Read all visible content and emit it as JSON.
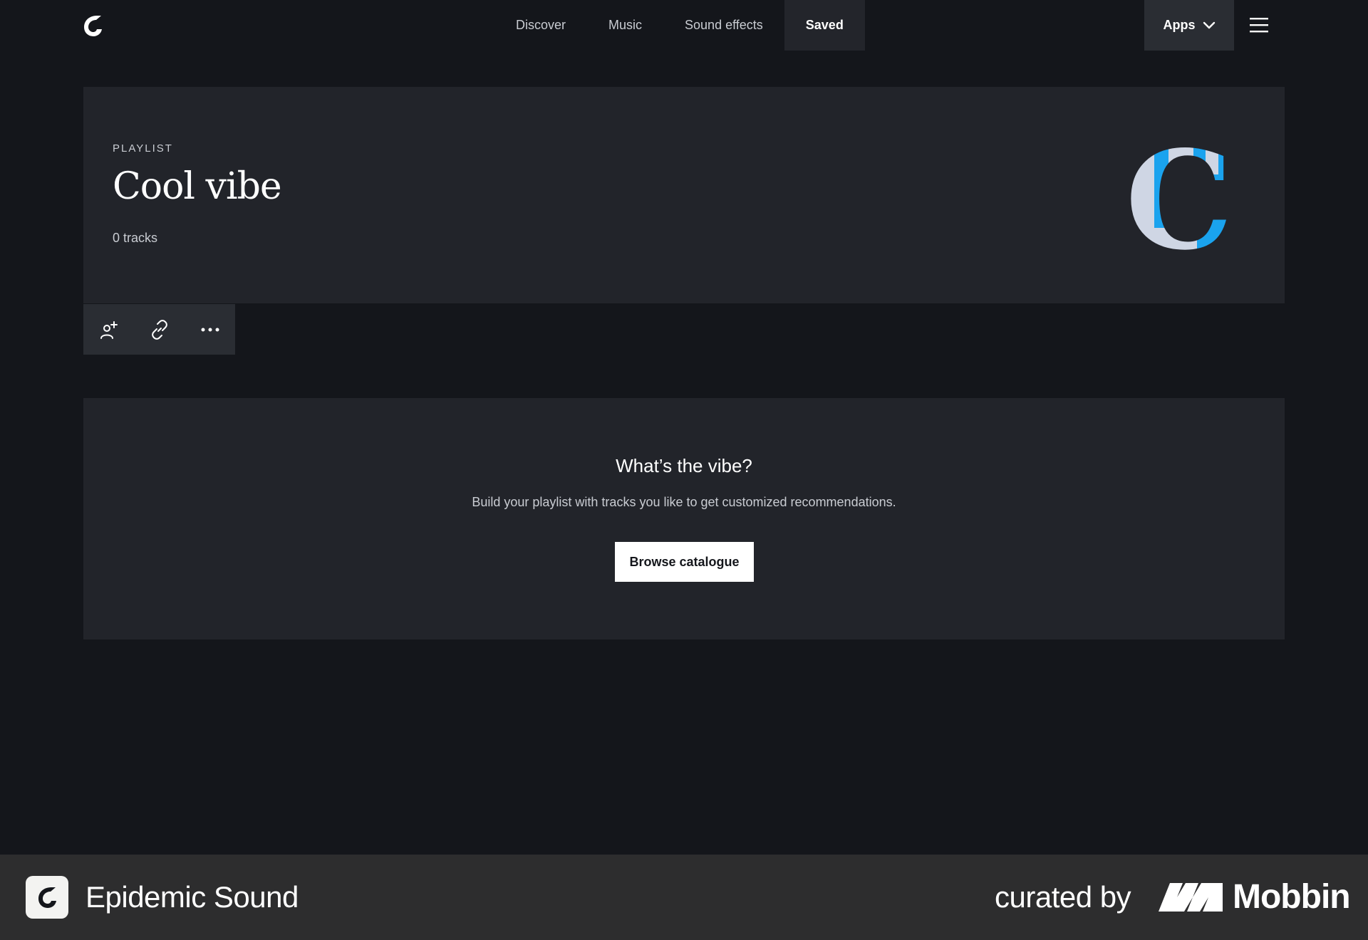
{
  "nav": {
    "items": [
      {
        "label": "Discover"
      },
      {
        "label": "Music"
      },
      {
        "label": "Sound effects"
      },
      {
        "label": "Saved"
      }
    ],
    "active": "Saved",
    "apps_label": "Apps"
  },
  "playlist": {
    "kicker": "PLAYLIST",
    "title": "Cool vibe",
    "track_count": "0 tracks",
    "cover_letter": "C"
  },
  "actions": [
    {
      "icon": "add-collaborator-icon"
    },
    {
      "icon": "link-icon"
    },
    {
      "icon": "more-icon"
    }
  ],
  "empty_state": {
    "title": "What’s the vibe?",
    "description": "Build your playlist with tracks you like to get customized recommendations.",
    "button_label": "Browse catalogue"
  },
  "footer": {
    "brand": "Epidemic Sound",
    "curated_by": "curated by",
    "partner": "Mobbin"
  },
  "colors": {
    "background": "#14161b",
    "card": "#22242a",
    "accent_blue": "#1aa3ee",
    "cover_light": "#cfd6e4",
    "footer": "#2d2d2e"
  }
}
